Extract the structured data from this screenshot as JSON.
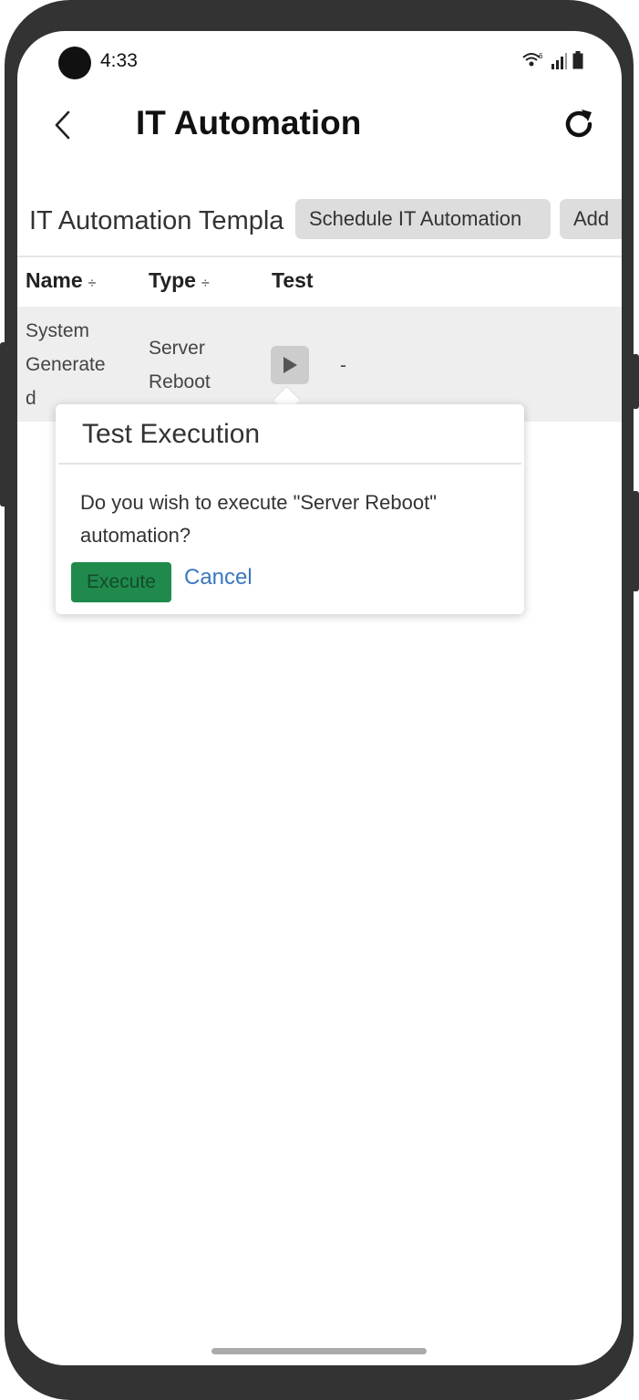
{
  "status_bar": {
    "time": "4:33"
  },
  "app_bar": {
    "title": "IT Automation"
  },
  "section": {
    "title": "IT Automation Templa",
    "schedule_label": "Schedule IT Automation",
    "add_label": "Add"
  },
  "table": {
    "headers": {
      "name": "Name",
      "type": "Type",
      "test": "Test",
      "sort_glyph": "÷"
    },
    "rows": [
      {
        "name_lines": [
          "System",
          "Generate",
          "d"
        ],
        "type_lines": [
          "Server",
          "Reboot"
        ],
        "extra": "-"
      }
    ]
  },
  "dialog": {
    "title": "Test Execution",
    "message": "Do you wish to execute \"Server Reboot\" automation?",
    "execute_label": "Execute",
    "cancel_label": "Cancel"
  },
  "colors": {
    "execute_button": "#1f8a4c",
    "cancel_link": "#3b78c0",
    "frame": "#333333"
  }
}
